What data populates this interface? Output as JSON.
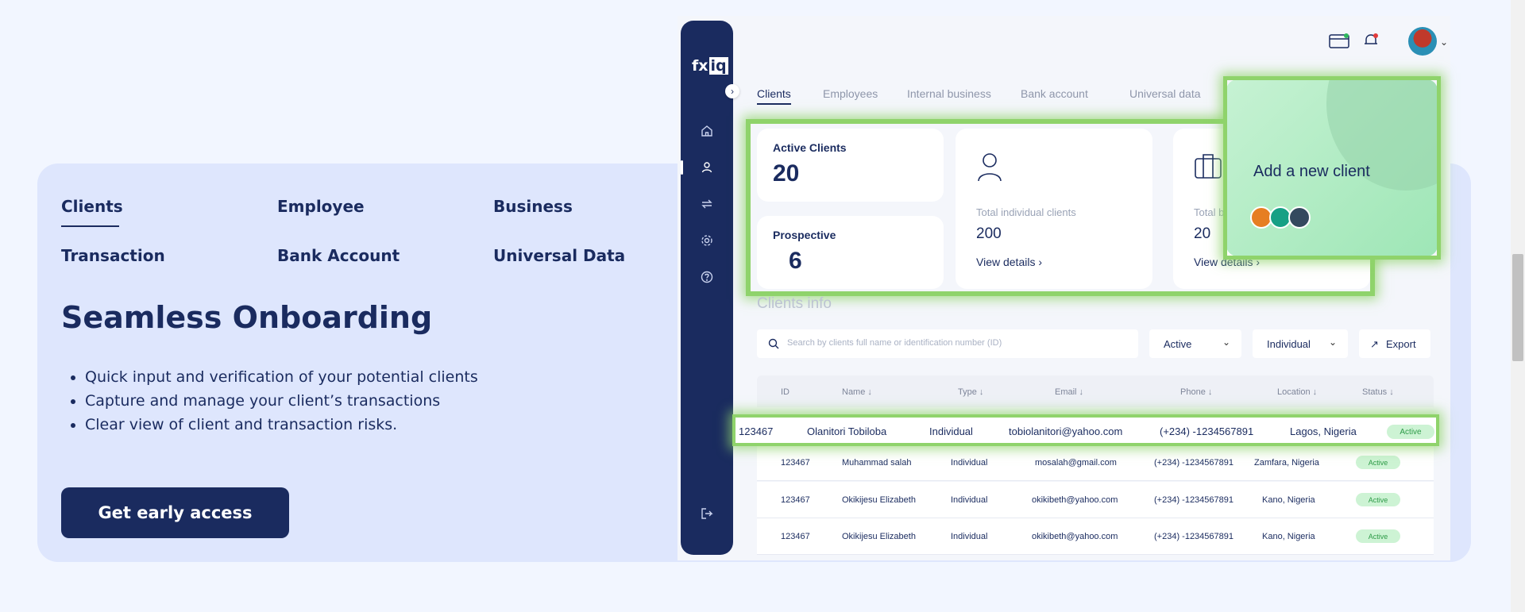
{
  "hero": {
    "tabs": [
      "Clients",
      "Employee",
      "Business",
      "Transaction",
      "Bank Account",
      "Universal Data"
    ],
    "title": "Seamless Onboarding",
    "bullets": [
      "Quick input and verification of your potential clients",
      "Capture and manage your client’s transactions",
      "Clear view of client and transaction risks."
    ],
    "cta": "Get early access"
  },
  "app": {
    "logo": {
      "a": "fx",
      "b": "iq"
    },
    "tabs": [
      "Clients",
      "Employees",
      "Internal business",
      "Bank account",
      "Universal data"
    ],
    "stats": {
      "active_label": "Active Clients",
      "active_value": "20",
      "prospective_label": "Prospective",
      "prospective_value": "6",
      "individual_label": "Total individual clients",
      "individual_value": "200",
      "business_label": "Total b",
      "business_value": "20",
      "view_details": "View details"
    },
    "add_client": "Add a new client",
    "section_title": "Clients info",
    "search_placeholder": "Search by clients full name or identification number (ID)",
    "filters": {
      "status": "Active",
      "type": "Individual",
      "export": "Export"
    },
    "columns": [
      "ID",
      "Name ↓",
      "Type ↓",
      "Email ↓",
      "Phone ↓",
      "Location ↓",
      "Status ↓"
    ],
    "highlighted_row": {
      "id": "123467",
      "name": "Olanitori Tobiloba",
      "type": "Individual",
      "email": "tobiolanitori@yahoo.com",
      "phone": "(+234) -1234567891",
      "location": "Lagos, Nigeria",
      "status": "Active"
    },
    "rows": [
      {
        "id": "123467",
        "name": "Muhammad salah",
        "type": "Individual",
        "email": "mosalah@gmail.com",
        "phone": "(+234) -1234567891",
        "location": "Zamfara, Nigeria",
        "status": "Active"
      },
      {
        "id": "123467",
        "name": "Okikijesu Elizabeth",
        "type": "Individual",
        "email": "okikibeth@yahoo.com",
        "phone": "(+234) -1234567891",
        "location": "Kano, Nigeria",
        "status": "Active"
      },
      {
        "id": "123467",
        "name": "Okikijesu Elizabeth",
        "type": "Individual",
        "email": "okikibeth@yahoo.com",
        "phone": "(+234) -1234567891",
        "location": "Kano, Nigeria",
        "status": "Active"
      }
    ]
  },
  "colors": {
    "navy": "#1a2b5f",
    "panel": "#dee6fd",
    "highlight": "#8fd36b",
    "active_badge": "#cdf3d4"
  }
}
